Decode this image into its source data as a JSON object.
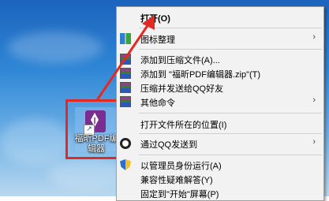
{
  "desktop": {
    "icon_label": "福昕PDF编辑器",
    "shortcut_glyph": "↗"
  },
  "menu": {
    "open": "打开(O)",
    "icon_arrange": "图标整理",
    "add_to_archive": "添加到压缩文件(A)...",
    "add_to_zip": "添加到 \"福昕PDF编辑器.zip\"(T)",
    "compress_send_qq": "压缩并发送给QQ好友",
    "other_commands": "其他命令",
    "open_file_location": "打开文件所在的位置(I)",
    "send_via_qq": "通过QQ发送到",
    "run_as_admin": "以管理员身份运行(A)",
    "troubleshoot": "兼容性疑难解答(Y)",
    "pin_to_start": "固定到\"开始\"屏幕(P)",
    "submenu_arrow": "›"
  },
  "colors": {
    "annotation_red": "#e32a22",
    "menu_bg": "#f2f2f2"
  }
}
